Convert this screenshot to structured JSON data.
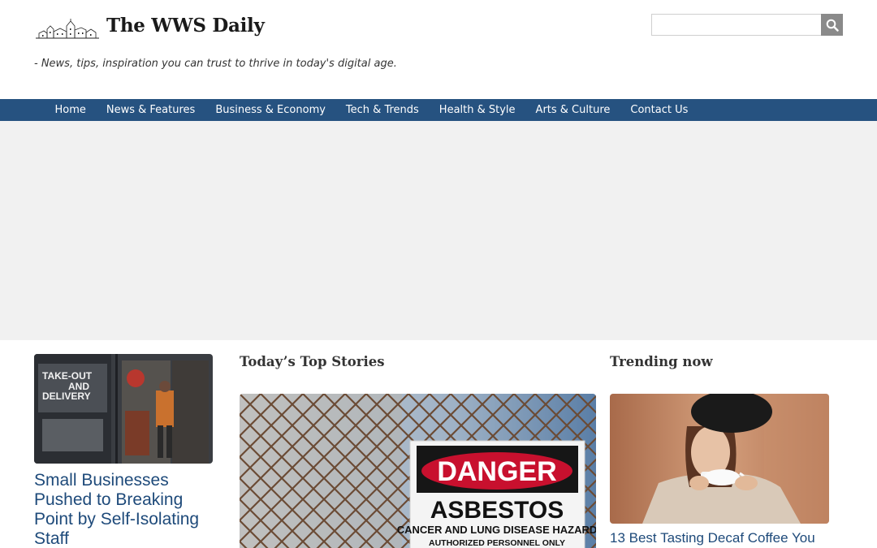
{
  "header": {
    "site_title": "The WWS Daily",
    "tagline": "- News, tips, inspiration you can trust to thrive in today's digital age.",
    "search_placeholder": "",
    "search_icon": "search-icon"
  },
  "nav": {
    "items": [
      {
        "label": "Home"
      },
      {
        "label": "News & Features"
      },
      {
        "label": "Business & Economy"
      },
      {
        "label": "Tech & Trends"
      },
      {
        "label": "Health & Style"
      },
      {
        "label": "Arts & Culture"
      },
      {
        "label": "Contact Us"
      }
    ]
  },
  "left_story": {
    "title": "Small Businesses Pushed to Breaking Point by Self-Isolating Staff",
    "image_sign_text": "TAKE-OUT AND DELIVERY"
  },
  "top_stories": {
    "heading": "Today’s Top Stories",
    "sign_line1": "DANGER",
    "sign_line2": "ASBESTOS",
    "sign_line3": "CANCER AND LUNG DISEASE HAZARD",
    "sign_line4": "AUTHORIZED PERSONNEL ONLY"
  },
  "trending": {
    "heading": "Trending now",
    "title": "13 Best Tasting Decaf Coffee You"
  },
  "colors": {
    "nav_bg": "#265280",
    "link": "#1e4a7a",
    "banner_bg": "#f1f1f1",
    "search_btn": "#8a8a8a"
  }
}
